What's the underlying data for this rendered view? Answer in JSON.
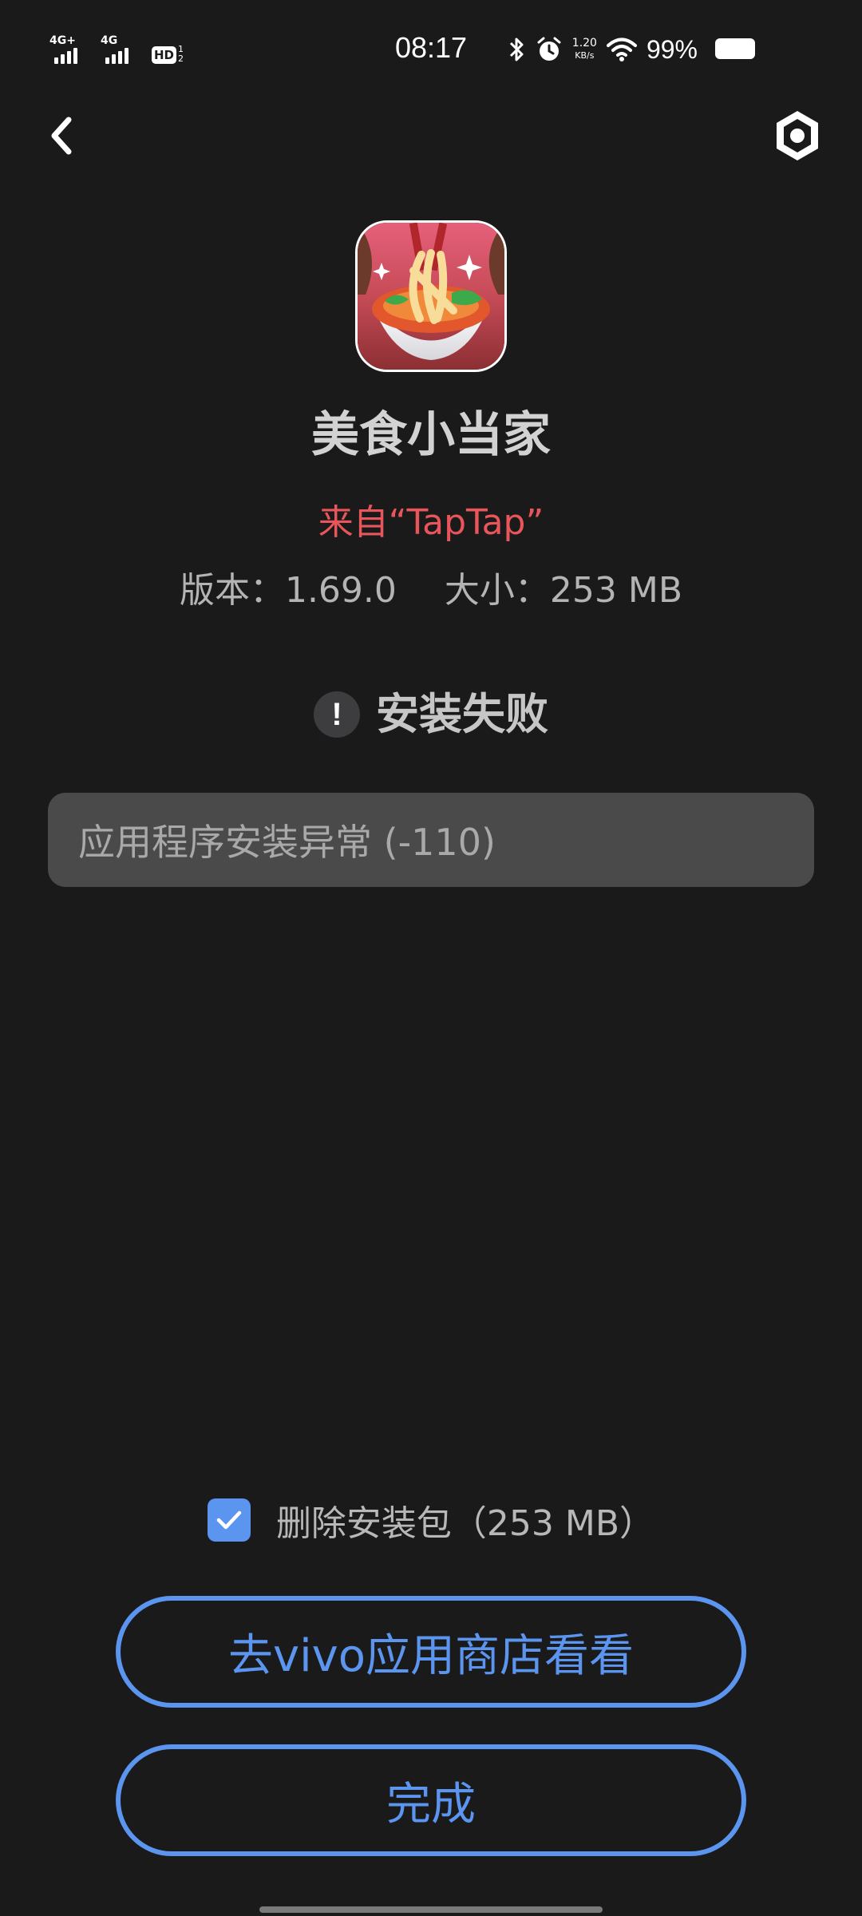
{
  "status_bar": {
    "network1": "4G+",
    "network2": "4G",
    "hd": "HD",
    "hd_sub1": "1",
    "hd_sub2": "2",
    "time": "08:17",
    "net_speed_value": "1.20",
    "net_speed_unit": "KB/s",
    "battery_percent": "99%"
  },
  "app": {
    "name": "美食小当家",
    "source": "来自“TapTap”",
    "version": "版本：1.69.0",
    "size": "大小：253 MB"
  },
  "install": {
    "status": "安装失败",
    "warn_glyph": "!",
    "error_message": "应用程序安装异常 (-110)"
  },
  "options": {
    "delete_package_label": "删除安装包（253 MB）",
    "delete_package_checked": true
  },
  "buttons": {
    "store": "去vivo应用商店看看",
    "done": "完成"
  },
  "colors": {
    "background": "#1a1a1b",
    "accent": "#5b95ef",
    "source_red": "#e8555a",
    "error_box": "#4a4a4b"
  }
}
